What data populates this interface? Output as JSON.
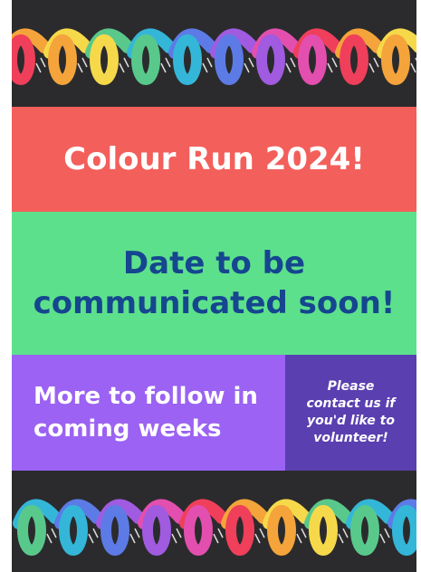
{
  "poster": {
    "title": "Colour Run 2024!",
    "date_lines": [
      "Date to be",
      "communicated soon!"
    ],
    "follow_lines": [
      "More to follow in",
      "coming weeks"
    ],
    "volunteer_lines": [
      "Please",
      "contact us if",
      "you'd like to",
      "volunteer!"
    ]
  },
  "colors": {
    "background": "#2b2b2d",
    "title_band": "#f35f5b",
    "date_band": "#5de08b",
    "date_text": "#15468f",
    "follow_band": "#9b62f3",
    "volunteer_band": "#5a3fb0",
    "coil_colors": [
      "#ef3f5a",
      "#f4a43a",
      "#f6d94a",
      "#59c98b",
      "#34b6d8",
      "#5d7be6",
      "#a05be0",
      "#e34fae"
    ]
  }
}
